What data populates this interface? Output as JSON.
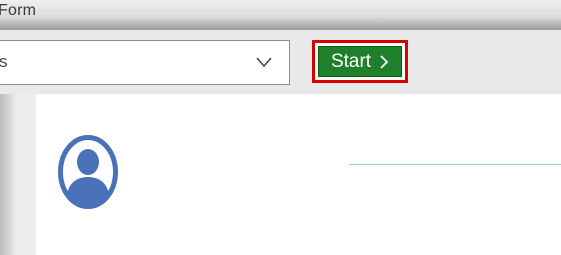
{
  "window": {
    "title": "Form"
  },
  "toolbar": {
    "combo": {
      "value": "s",
      "icon": "chevron-down-icon"
    },
    "start_button": {
      "label": "Start",
      "icon": "chevron-right-icon",
      "highlight_color": "#d50000",
      "button_color": "#1f7f2a"
    }
  },
  "content": {
    "avatar_icon": "user-avatar-icon",
    "avatar_color": "#4a72b8"
  }
}
